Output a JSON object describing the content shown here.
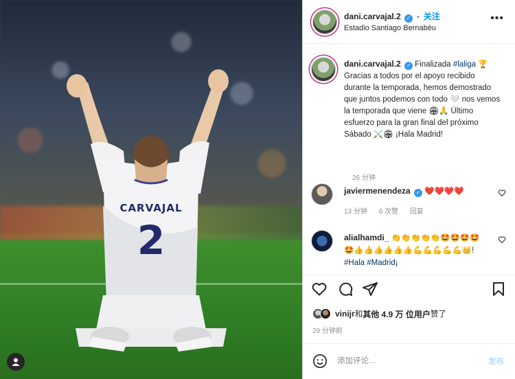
{
  "post": {
    "username": "dani.carvajal.2",
    "follow_label": "关注",
    "location": "Estadio Santiago Bernabéu",
    "more_icon": "more-horizontal-icon",
    "jersey_name": "CARVAJAL",
    "jersey_number": "2"
  },
  "caption": {
    "username": "dani.carvajal.2",
    "text_before_tag": "Finalizada ",
    "hashtag": "#laliga",
    "text_after_tag": " 🏆 Gracias a todos por el apoyo recibido durante la temporada, hemos demostrado que juntos podemos con todo 🤍 nos vemos la temporada que viene 🏟🙏 Último esfuerzo para la gran final del próximo Sábado ⚔️🏟 ¡Hala Madrid!",
    "time": "26 分钟"
  },
  "comments": [
    {
      "username": "javiermenendeza",
      "text": "❤️❤️❤️❤️",
      "time": "13 分钟",
      "likes": "6 次赞",
      "reply": "回复"
    },
    {
      "username": "alialhamdi_",
      "text": "👏👏👏👏👏🤩🤩🤩🤩🤩👍👍👍👍👍👍💪💪💪💪💪👑!",
      "tags": "#Hala #Madrid",
      "tag_suffix": "¡"
    }
  ],
  "likes": {
    "liker": "vinijr",
    "middle": " 和 ",
    "others": "其他 4.9 万 位用户",
    "suffix": " 赞了"
  },
  "post_time": "29 分钟前",
  "add_comment": {
    "placeholder": "添加评论...",
    "post_label": "发布"
  },
  "colors": {
    "accent": "#0095f6",
    "hashtag": "#00376b",
    "verified": "#3897f0",
    "muted": "#8e8e8e",
    "post_disabled": "#b2dffc"
  }
}
